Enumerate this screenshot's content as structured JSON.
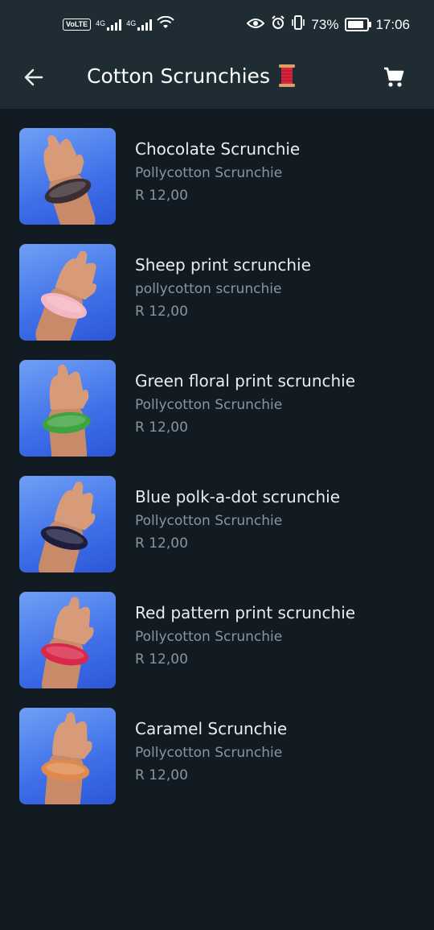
{
  "status_bar": {
    "network_a": "4G",
    "network_b": "4G",
    "battery_percent": "73%",
    "battery_level": 0.73,
    "time": "17:06",
    "volte": "VoLTE"
  },
  "header": {
    "title": "Cotton Scrunchies",
    "title_emoji": "spool-of-thread",
    "back_icon": "arrow-left-icon",
    "cart_icon": "cart-icon"
  },
  "colors": {
    "background": "#121b22",
    "header": "#1f2c34",
    "primary_text": "#e9edef",
    "secondary_text": "#8696a0"
  },
  "products": [
    {
      "name": "Chocolate Scrunchie",
      "description": "Pollycotton Scrunchie",
      "price": "R 12,00",
      "scrunchie_color": "#3a2e33"
    },
    {
      "name": "Sheep print scrunchie",
      "description": "pollycotton scrunchie",
      "price": "R 12,00",
      "scrunchie_color": "#f4b6c2"
    },
    {
      "name": "Green floral print scrunchie",
      "description": "Pollycotton Scrunchie",
      "price": "R 12,00",
      "scrunchie_color": "#3fa33f"
    },
    {
      "name": "Blue polk-a-dot scrunchie",
      "description": "Pollycotton Scrunchie",
      "price": "R 12,00",
      "scrunchie_color": "#1d1d3f"
    },
    {
      "name": "Red pattern print scrunchie",
      "description": "Pollycotton Scrunchie",
      "price": "R 12,00",
      "scrunchie_color": "#d8294a"
    },
    {
      "name": "Caramel Scrunchie",
      "description": "Pollycotton Scrunchie",
      "price": "R 12,00",
      "scrunchie_color": "#e0894f"
    }
  ]
}
